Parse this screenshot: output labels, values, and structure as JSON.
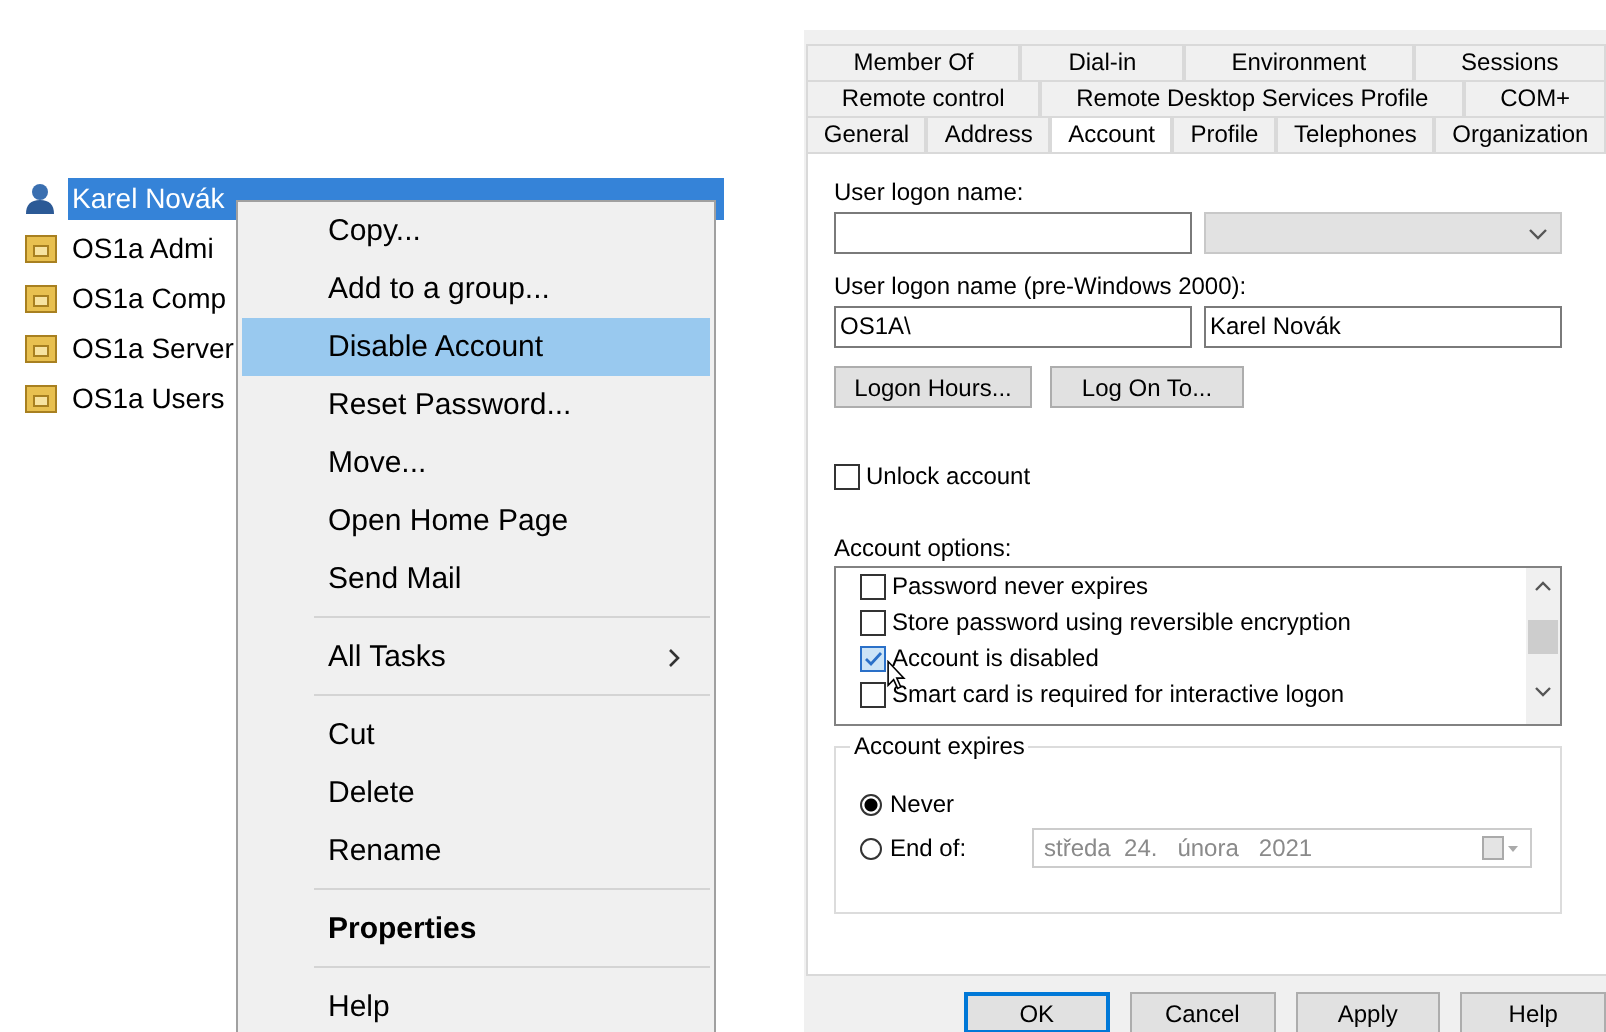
{
  "tree": {
    "items": [
      {
        "label": "Karel Novák",
        "kind": "user",
        "selected": true
      },
      {
        "label": "OS1a Admi",
        "kind": "unit",
        "selected": false
      },
      {
        "label": "OS1a Comp",
        "kind": "unit",
        "selected": false
      },
      {
        "label": "OS1a Server",
        "kind": "unit",
        "selected": false
      },
      {
        "label": "OS1a Users",
        "kind": "unit",
        "selected": false
      }
    ]
  },
  "context_menu": {
    "items": [
      {
        "kind": "item",
        "label": "Copy...",
        "selected": false
      },
      {
        "kind": "item",
        "label": "Add to a group...",
        "selected": false
      },
      {
        "kind": "item",
        "label": "Disable Account",
        "selected": true
      },
      {
        "kind": "item",
        "label": "Reset Password...",
        "selected": false
      },
      {
        "kind": "item",
        "label": "Move...",
        "selected": false
      },
      {
        "kind": "item",
        "label": "Open Home Page",
        "selected": false
      },
      {
        "kind": "item",
        "label": "Send Mail",
        "selected": false
      },
      {
        "kind": "separator"
      },
      {
        "kind": "submenu",
        "label": "All Tasks",
        "selected": false
      },
      {
        "kind": "separator"
      },
      {
        "kind": "item",
        "label": "Cut",
        "selected": false
      },
      {
        "kind": "item",
        "label": "Delete",
        "selected": false
      },
      {
        "kind": "item",
        "label": "Rename",
        "selected": false
      },
      {
        "kind": "separator"
      },
      {
        "kind": "default",
        "label": "Properties",
        "selected": false
      },
      {
        "kind": "separator"
      },
      {
        "kind": "item",
        "label": "Help",
        "selected": false
      }
    ]
  },
  "dialog": {
    "tab_rows": [
      [
        {
          "label": "Member Of",
          "selected": false
        },
        {
          "label": "Dial-in",
          "selected": false
        },
        {
          "label": "Environment",
          "selected": false
        },
        {
          "label": "Sessions",
          "selected": false
        }
      ],
      [
        {
          "label": "Remote control",
          "selected": false
        },
        {
          "label": "Remote Desktop Services Profile",
          "selected": false
        },
        {
          "label": "COM+",
          "selected": false
        }
      ],
      [
        {
          "label": "General",
          "selected": false
        },
        {
          "label": "Address",
          "selected": false
        },
        {
          "label": "Account",
          "selected": true
        },
        {
          "label": "Profile",
          "selected": false
        },
        {
          "label": "Telephones",
          "selected": false
        },
        {
          "label": "Organization",
          "selected": false
        }
      ]
    ],
    "user_logon_name": {
      "label": "User logon name:",
      "suffix_disabled": true
    },
    "pre_windows_2000": {
      "label": "User logon name (pre-Windows 2000):",
      "domain": "OS1A\\",
      "name": "Karel Novák"
    },
    "buttons": [
      "Logon Hours...",
      "Log On To..."
    ],
    "unlock": {
      "label": "Unlock account",
      "checked": false
    },
    "account_options": {
      "label": "Account options:",
      "items": [
        {
          "label": "Password never expires",
          "checked": false
        },
        {
          "label": "Store password using reversible encryption",
          "checked": false
        },
        {
          "label": "Account is disabled",
          "checked": true
        },
        {
          "label": "Smart card is required for interactive logon",
          "checked": false
        }
      ]
    },
    "account_expires": {
      "title": "Account expires",
      "options": [
        {
          "label": "Never",
          "selected": true
        },
        {
          "label": "End of:",
          "selected": false
        }
      ],
      "date": {
        "value": "středa  24.   února   2021",
        "disabled": true
      }
    },
    "footer_buttons": [
      {
        "label": "OK",
        "default": true
      },
      {
        "label": "Cancel",
        "default": false
      },
      {
        "label": "Apply",
        "default": false
      },
      {
        "label": "Help",
        "default": false
      }
    ]
  }
}
